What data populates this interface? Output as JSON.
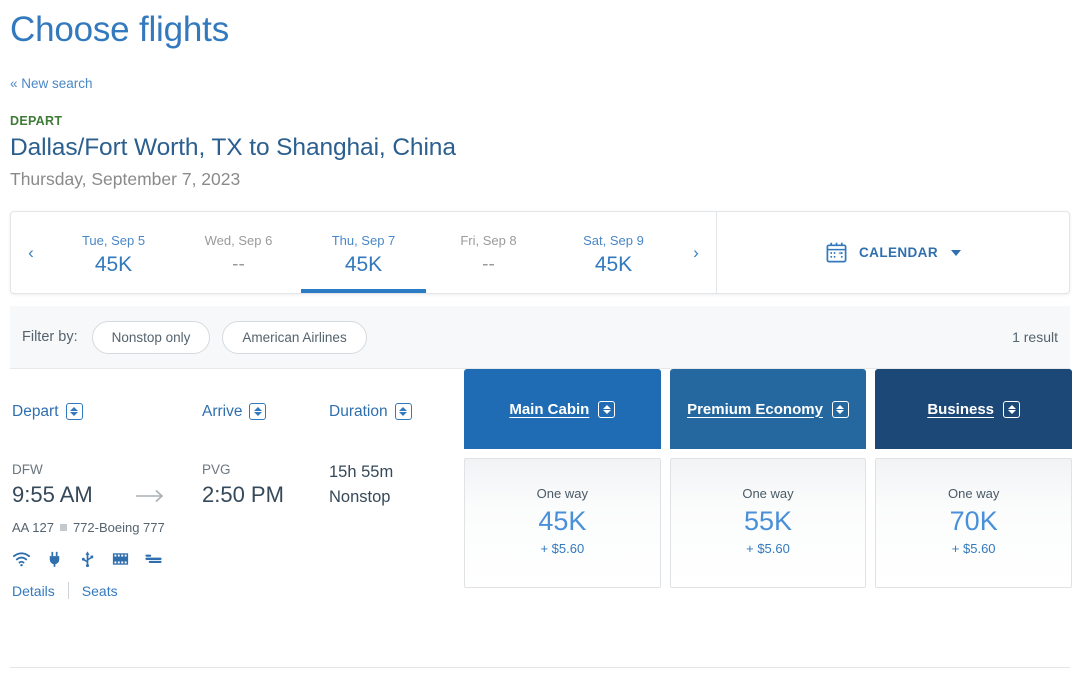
{
  "header": {
    "page_title": "Choose flights",
    "new_search_link": "« New search",
    "depart_label": "DEPART",
    "route": "Dallas/Fort Worth, TX to Shanghai, China",
    "date": "Thursday, September 7, 2023"
  },
  "date_strip": {
    "prev_icon": "‹",
    "next_icon": "›",
    "tabs": [
      {
        "day": "Tue, Sep 5",
        "price": "45K",
        "state": "available"
      },
      {
        "day": "Wed, Sep 6",
        "price": "--",
        "state": "unavailable"
      },
      {
        "day": "Thu, Sep 7",
        "price": "45K",
        "state": "selected"
      },
      {
        "day": "Fri, Sep 8",
        "price": "--",
        "state": "unavailable"
      },
      {
        "day": "Sat, Sep 9",
        "price": "45K",
        "state": "available"
      }
    ],
    "calendar_label": "CALENDAR",
    "calendar_icon": "calendar-icon",
    "calendar_caret": "chevron-down-icon"
  },
  "filters": {
    "label": "Filter by:",
    "chips": [
      "Nonstop only",
      "American Airlines"
    ],
    "result_count": "1 result"
  },
  "sort_columns": [
    {
      "label": "Depart",
      "icon": "sort-updown-icon"
    },
    {
      "label": "Arrive",
      "icon": "sort-updown-icon"
    },
    {
      "label": "Duration",
      "icon": "sort-updown-icon"
    }
  ],
  "cabins": [
    {
      "label": "Main Cabin",
      "color": "#1f6cb4",
      "icon": "sort-updown-icon"
    },
    {
      "label": "Premium Economy",
      "color": "#24689f",
      "icon": "sort-updown-icon"
    },
    {
      "label": "Business",
      "color": "#1c4878",
      "icon": "sort-updown-icon"
    }
  ],
  "flight": {
    "origin_code": "DFW",
    "origin_time": "9:55 AM",
    "arrow_icon": "arrow-right-icon",
    "dest_code": "PVG",
    "dest_time": "2:50 PM",
    "duration": "15h 55m",
    "stops": "Nonstop",
    "flight_number": "AA 127",
    "aircraft": "772-Boeing 777",
    "amenities": [
      "wifi-icon",
      "power-plug-icon",
      "usb-icon",
      "entertainment-icon",
      "lie-flat-seat-icon"
    ],
    "details_link": "Details",
    "seats_link": "Seats"
  },
  "prices": [
    {
      "label": "One way",
      "miles": "45K",
      "tax": "+ $5.60"
    },
    {
      "label": "One way",
      "miles": "55K",
      "tax": "+ $5.60"
    },
    {
      "label": "One way",
      "miles": "70K",
      "tax": "+ $5.60"
    }
  ],
  "colors": {
    "brand_blue": "#3379bd",
    "navy": "#1c4878",
    "green": "#3f7b37"
  }
}
